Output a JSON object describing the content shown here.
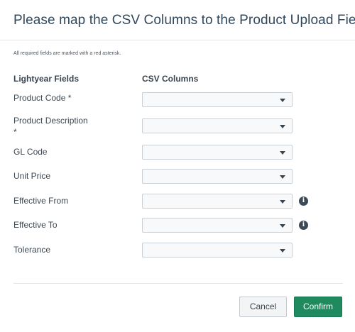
{
  "dialog": {
    "title": "Please map the CSV Columns to the Product Upload Field",
    "hint": "All required fields are marked with a red asterisk."
  },
  "columns": {
    "left_header": "Lightyear Fields",
    "right_header": "CSV Columns"
  },
  "rows": [
    {
      "label": "Product Code *",
      "selected": ""
    },
    {
      "label": "Product Description *",
      "selected": ""
    },
    {
      "label": "GL Code",
      "selected": ""
    },
    {
      "label": "Unit Price",
      "selected": ""
    },
    {
      "label": "Effective From",
      "selected": ""
    },
    {
      "label": "Effective To",
      "selected": ""
    },
    {
      "label": "Tolerance",
      "selected": ""
    }
  ],
  "icons": {
    "dropdown": "chevron-down-icon",
    "info": "info-icon",
    "info_glyph": "i"
  },
  "buttons": {
    "cancel_label": "Cancel",
    "confirm_label": "Confirm"
  },
  "colors": {
    "accent": "#1f8a5e",
    "title": "#31485c",
    "info_icon": "#3c4a57"
  }
}
